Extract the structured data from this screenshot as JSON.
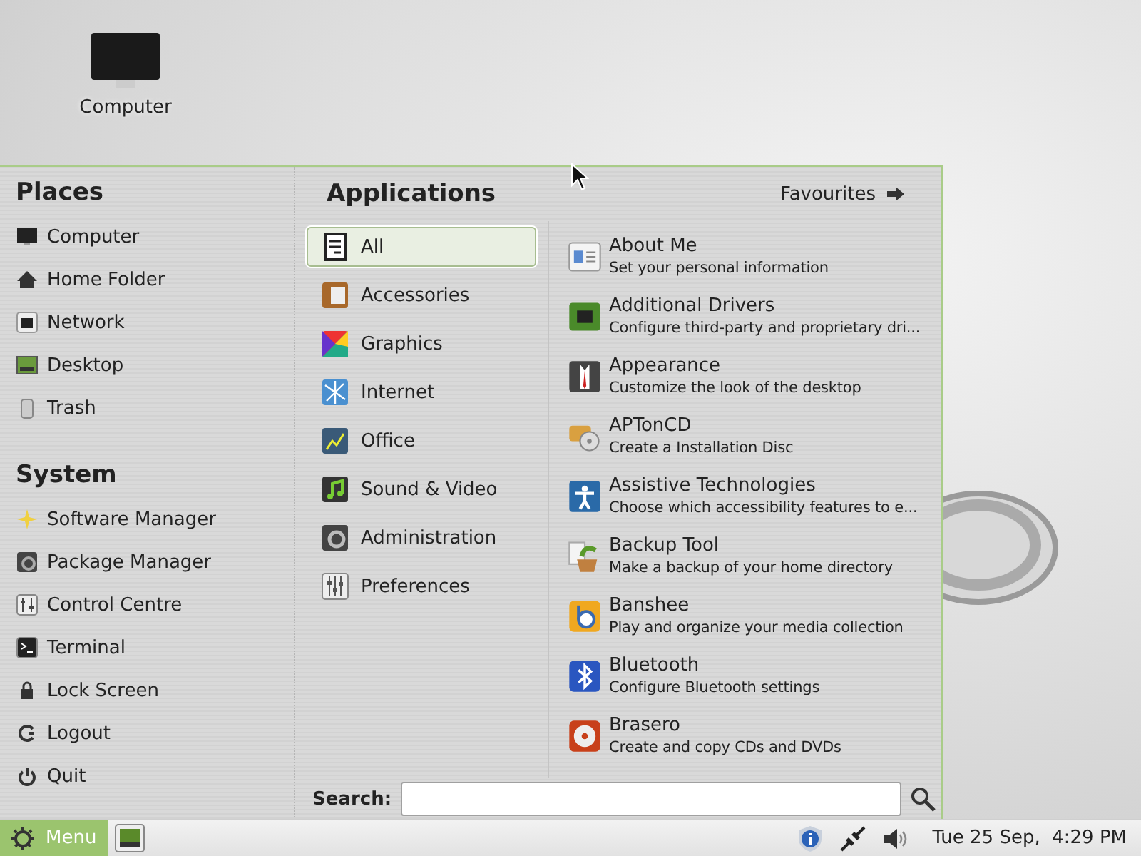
{
  "desktop_icons": [
    {
      "label": "Computer"
    }
  ],
  "menu": {
    "places": {
      "title": "Places",
      "items": [
        {
          "label": "Computer"
        },
        {
          "label": "Home Folder"
        },
        {
          "label": "Network"
        },
        {
          "label": "Desktop"
        },
        {
          "label": "Trash"
        }
      ]
    },
    "system": {
      "title": "System",
      "items": [
        {
          "label": "Software Manager"
        },
        {
          "label": "Package Manager"
        },
        {
          "label": "Control Centre"
        },
        {
          "label": "Terminal"
        },
        {
          "label": "Lock Screen"
        },
        {
          "label": "Logout"
        },
        {
          "label": "Quit"
        }
      ]
    },
    "applications_title": "Applications",
    "favourites_button": "Favourites",
    "categories": [
      {
        "label": "All",
        "selected": true
      },
      {
        "label": "Accessories",
        "selected": false
      },
      {
        "label": "Graphics",
        "selected": false
      },
      {
        "label": "Internet",
        "selected": false
      },
      {
        "label": "Office",
        "selected": false
      },
      {
        "label": "Sound & Video",
        "selected": false
      },
      {
        "label": "Administration",
        "selected": false
      },
      {
        "label": "Preferences",
        "selected": false
      }
    ],
    "apps": [
      {
        "name": "About Me",
        "description": "Set your personal information"
      },
      {
        "name": "Additional Drivers",
        "description": "Configure third-party and proprietary dri..."
      },
      {
        "name": "Appearance",
        "description": "Customize the look of the desktop"
      },
      {
        "name": "APTonCD",
        "description": "Create a Installation Disc"
      },
      {
        "name": "Assistive Technologies",
        "description": "Choose which accessibility features to e..."
      },
      {
        "name": "Backup Tool",
        "description": "Make a backup of your home directory"
      },
      {
        "name": "Banshee",
        "description": "Play and organize your media collection"
      },
      {
        "name": "Bluetooth",
        "description": "Configure Bluetooth settings"
      },
      {
        "name": "Brasero",
        "description": "Create and copy CDs and DVDs"
      }
    ],
    "search": {
      "label": "Search:"
    }
  },
  "taskbar": {
    "menu_button": "Menu",
    "clock": "Tue 25 Sep,  4:29 PM"
  }
}
